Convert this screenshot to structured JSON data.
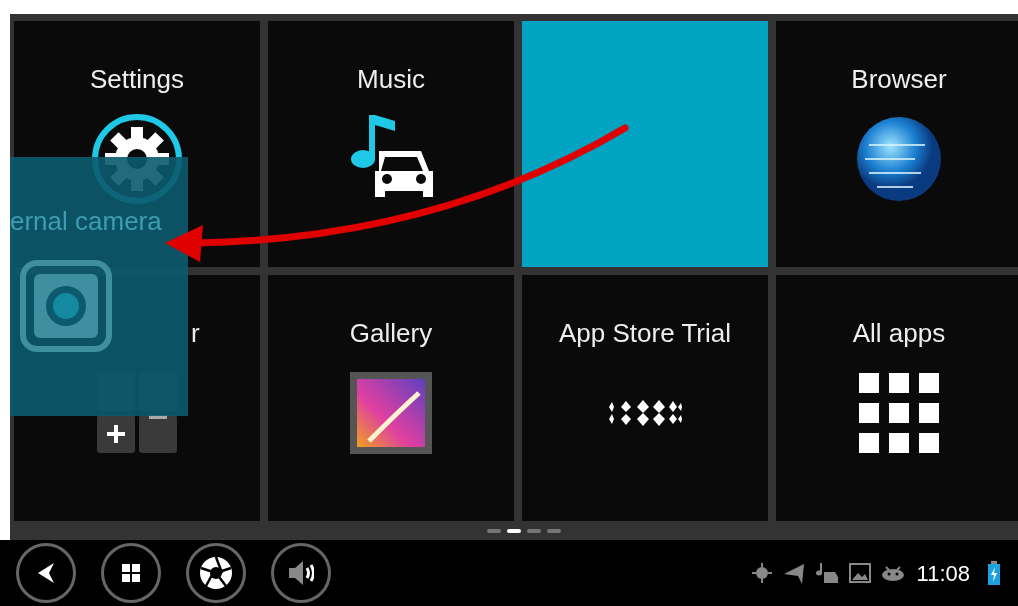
{
  "tiles": [
    {
      "kind": "app",
      "label": "Settings"
    },
    {
      "kind": "app",
      "label": "Music"
    },
    {
      "kind": "slot"
    },
    {
      "kind": "app",
      "label": "Browser"
    },
    {
      "kind": "app",
      "label": "r",
      "covered_by_drag": true
    },
    {
      "kind": "app",
      "label": "Gallery"
    },
    {
      "kind": "app",
      "label": "App Store Trial"
    },
    {
      "kind": "app",
      "label": "All apps"
    }
  ],
  "dragged_tile": {
    "label": "ernal camera"
  },
  "page_indicator": [
    {
      "selected": false
    },
    {
      "selected": true
    },
    {
      "selected": false
    },
    {
      "selected": false
    }
  ],
  "status_bar": {
    "time": "11:08"
  }
}
